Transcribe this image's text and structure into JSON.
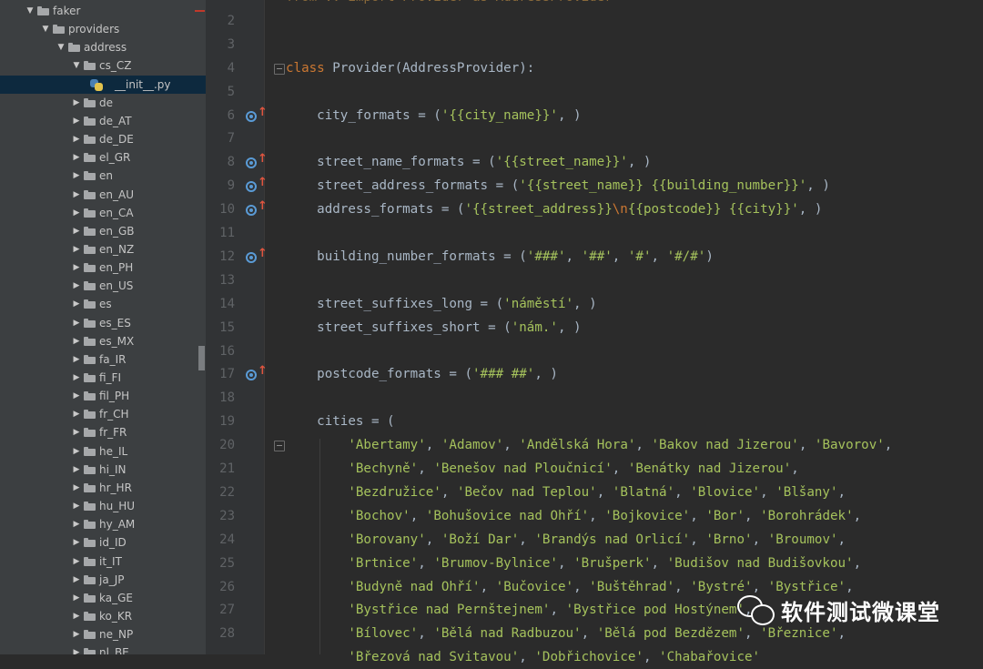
{
  "project_tree": [
    {
      "label": "faker",
      "depth": 0,
      "expanded": true,
      "type": "folder"
    },
    {
      "label": "providers",
      "depth": 1,
      "expanded": true,
      "type": "folder"
    },
    {
      "label": "address",
      "depth": 2,
      "expanded": true,
      "type": "folder"
    },
    {
      "label": "cs_CZ",
      "depth": 3,
      "expanded": true,
      "type": "folder"
    },
    {
      "label": "__init__.py",
      "depth": 4,
      "type": "python-file",
      "selected": true
    },
    {
      "label": "de",
      "depth": 3,
      "expanded": false,
      "type": "folder"
    },
    {
      "label": "de_AT",
      "depth": 3,
      "expanded": false,
      "type": "folder"
    },
    {
      "label": "de_DE",
      "depth": 3,
      "expanded": false,
      "type": "folder"
    },
    {
      "label": "el_GR",
      "depth": 3,
      "expanded": false,
      "type": "folder"
    },
    {
      "label": "en",
      "depth": 3,
      "expanded": false,
      "type": "folder"
    },
    {
      "label": "en_AU",
      "depth": 3,
      "expanded": false,
      "type": "folder"
    },
    {
      "label": "en_CA",
      "depth": 3,
      "expanded": false,
      "type": "folder"
    },
    {
      "label": "en_GB",
      "depth": 3,
      "expanded": false,
      "type": "folder"
    },
    {
      "label": "en_NZ",
      "depth": 3,
      "expanded": false,
      "type": "folder"
    },
    {
      "label": "en_PH",
      "depth": 3,
      "expanded": false,
      "type": "folder"
    },
    {
      "label": "en_US",
      "depth": 3,
      "expanded": false,
      "type": "folder"
    },
    {
      "label": "es",
      "depth": 3,
      "expanded": false,
      "type": "folder"
    },
    {
      "label": "es_ES",
      "depth": 3,
      "expanded": false,
      "type": "folder"
    },
    {
      "label": "es_MX",
      "depth": 3,
      "expanded": false,
      "type": "folder"
    },
    {
      "label": "fa_IR",
      "depth": 3,
      "expanded": false,
      "type": "folder"
    },
    {
      "label": "fi_FI",
      "depth": 3,
      "expanded": false,
      "type": "folder"
    },
    {
      "label": "fil_PH",
      "depth": 3,
      "expanded": false,
      "type": "folder"
    },
    {
      "label": "fr_CH",
      "depth": 3,
      "expanded": false,
      "type": "folder"
    },
    {
      "label": "fr_FR",
      "depth": 3,
      "expanded": false,
      "type": "folder"
    },
    {
      "label": "he_IL",
      "depth": 3,
      "expanded": false,
      "type": "folder"
    },
    {
      "label": "hi_IN",
      "depth": 3,
      "expanded": false,
      "type": "folder"
    },
    {
      "label": "hr_HR",
      "depth": 3,
      "expanded": false,
      "type": "folder"
    },
    {
      "label": "hu_HU",
      "depth": 3,
      "expanded": false,
      "type": "folder"
    },
    {
      "label": "hy_AM",
      "depth": 3,
      "expanded": false,
      "type": "folder"
    },
    {
      "label": "id_ID",
      "depth": 3,
      "expanded": false,
      "type": "folder"
    },
    {
      "label": "it_IT",
      "depth": 3,
      "expanded": false,
      "type": "folder"
    },
    {
      "label": "ja_JP",
      "depth": 3,
      "expanded": false,
      "type": "folder"
    },
    {
      "label": "ka_GE",
      "depth": 3,
      "expanded": false,
      "type": "folder"
    },
    {
      "label": "ko_KR",
      "depth": 3,
      "expanded": false,
      "type": "folder"
    },
    {
      "label": "ne_NP",
      "depth": 3,
      "expanded": false,
      "type": "folder"
    },
    {
      "label": "nl_BE",
      "depth": 3,
      "expanded": false,
      "type": "folder"
    }
  ],
  "editor_lines": [
    {
      "n": "",
      "segs": [
        {
          "t": "from .. import Provider as AddressProvider",
          "k": "dim"
        }
      ]
    },
    {
      "n": "2",
      "segs": []
    },
    {
      "n": "3",
      "segs": []
    },
    {
      "n": "4",
      "fold": true,
      "segs": [
        {
          "t": "class ",
          "k": "kw"
        },
        {
          "t": "Provider(AddressProvider):",
          "k": "plain"
        }
      ]
    },
    {
      "n": "5",
      "segs": []
    },
    {
      "n": "6",
      "override": true,
      "segs": [
        {
          "t": "    city_formats = (",
          "k": "plain"
        },
        {
          "t": "'{{city_name}}'",
          "k": "str"
        },
        {
          "t": ", )",
          "k": "plain"
        }
      ]
    },
    {
      "n": "7",
      "segs": []
    },
    {
      "n": "8",
      "override": true,
      "segs": [
        {
          "t": "    street_name_formats = (",
          "k": "plain"
        },
        {
          "t": "'{{street_name}}'",
          "k": "str"
        },
        {
          "t": ", )",
          "k": "plain"
        }
      ]
    },
    {
      "n": "9",
      "override": true,
      "segs": [
        {
          "t": "    street_address_formats = (",
          "k": "plain"
        },
        {
          "t": "'{{street_name}} {{building_number}}'",
          "k": "str"
        },
        {
          "t": ", )",
          "k": "plain"
        }
      ]
    },
    {
      "n": "10",
      "override": true,
      "segs": [
        {
          "t": "    address_formats = (",
          "k": "plain"
        },
        {
          "t": "'{{street_address}}",
          "k": "str"
        },
        {
          "t": "\\n",
          "k": "esc"
        },
        {
          "t": "{{postcode}} {{city}}'",
          "k": "str"
        },
        {
          "t": ", )",
          "k": "plain"
        }
      ]
    },
    {
      "n": "11",
      "segs": []
    },
    {
      "n": "12",
      "override": true,
      "segs": [
        {
          "t": "    building_number_formats = (",
          "k": "plain"
        },
        {
          "t": "'###'",
          "k": "str"
        },
        {
          "t": ", ",
          "k": "plain"
        },
        {
          "t": "'##'",
          "k": "str"
        },
        {
          "t": ", ",
          "k": "plain"
        },
        {
          "t": "'#'",
          "k": "str"
        },
        {
          "t": ", ",
          "k": "plain"
        },
        {
          "t": "'#/#'",
          "k": "str"
        },
        {
          "t": ")",
          "k": "plain"
        }
      ]
    },
    {
      "n": "13",
      "segs": []
    },
    {
      "n": "14",
      "segs": [
        {
          "t": "    street_suffixes_long = (",
          "k": "plain"
        },
        {
          "t": "'náměstí'",
          "k": "str"
        },
        {
          "t": ", )",
          "k": "plain"
        }
      ]
    },
    {
      "n": "15",
      "segs": [
        {
          "t": "    street_suffixes_short = (",
          "k": "plain"
        },
        {
          "t": "'nám.'",
          "k": "str"
        },
        {
          "t": ", )",
          "k": "plain"
        }
      ]
    },
    {
      "n": "16",
      "segs": []
    },
    {
      "n": "17",
      "override": true,
      "segs": [
        {
          "t": "    postcode_formats = (",
          "k": "plain"
        },
        {
          "t": "'### ##'",
          "k": "str"
        },
        {
          "t": ", )",
          "k": "plain"
        }
      ]
    },
    {
      "n": "18",
      "segs": []
    },
    {
      "n": "19",
      "segs": [
        {
          "t": "    cities = (",
          "k": "plain"
        }
      ]
    },
    {
      "n": "20",
      "fold": true,
      "segs": [
        {
          "t": "        ",
          "k": "plain"
        },
        {
          "t": "'Abertamy'",
          "k": "str"
        },
        {
          "t": ", ",
          "k": "plain"
        },
        {
          "t": "'Adamov'",
          "k": "str"
        },
        {
          "t": ", ",
          "k": "plain"
        },
        {
          "t": "'Andělská Hora'",
          "k": "str"
        },
        {
          "t": ", ",
          "k": "plain"
        },
        {
          "t": "'Bakov nad Jizerou'",
          "k": "str"
        },
        {
          "t": ", ",
          "k": "plain"
        },
        {
          "t": "'Bavorov'",
          "k": "str"
        },
        {
          "t": ",",
          "k": "plain"
        }
      ]
    },
    {
      "n": "21",
      "segs": [
        {
          "t": "        ",
          "k": "plain"
        },
        {
          "t": "'Bechyně'",
          "k": "str"
        },
        {
          "t": ", ",
          "k": "plain"
        },
        {
          "t": "'Benešov nad Ploučnicí'",
          "k": "str"
        },
        {
          "t": ", ",
          "k": "plain"
        },
        {
          "t": "'Benátky nad Jizerou'",
          "k": "str"
        },
        {
          "t": ",",
          "k": "plain"
        }
      ]
    },
    {
      "n": "22",
      "segs": [
        {
          "t": "        ",
          "k": "plain"
        },
        {
          "t": "'Bezdružice'",
          "k": "str"
        },
        {
          "t": ", ",
          "k": "plain"
        },
        {
          "t": "'Bečov nad Teplou'",
          "k": "str"
        },
        {
          "t": ", ",
          "k": "plain"
        },
        {
          "t": "'Blatná'",
          "k": "str"
        },
        {
          "t": ", ",
          "k": "plain"
        },
        {
          "t": "'Blovice'",
          "k": "str"
        },
        {
          "t": ", ",
          "k": "plain"
        },
        {
          "t": "'Blšany'",
          "k": "str"
        },
        {
          "t": ",",
          "k": "plain"
        }
      ]
    },
    {
      "n": "23",
      "segs": [
        {
          "t": "        ",
          "k": "plain"
        },
        {
          "t": "'Bochov'",
          "k": "str"
        },
        {
          "t": ", ",
          "k": "plain"
        },
        {
          "t": "'Bohušovice nad Ohří'",
          "k": "str"
        },
        {
          "t": ", ",
          "k": "plain"
        },
        {
          "t": "'Bojkovice'",
          "k": "str"
        },
        {
          "t": ", ",
          "k": "plain"
        },
        {
          "t": "'Bor'",
          "k": "str"
        },
        {
          "t": ", ",
          "k": "plain"
        },
        {
          "t": "'Borohrádek'",
          "k": "str"
        },
        {
          "t": ",",
          "k": "plain"
        }
      ]
    },
    {
      "n": "24",
      "segs": [
        {
          "t": "        ",
          "k": "plain"
        },
        {
          "t": "'Borovany'",
          "k": "str"
        },
        {
          "t": ", ",
          "k": "plain"
        },
        {
          "t": "'Boží Dar'",
          "k": "str"
        },
        {
          "t": ", ",
          "k": "plain"
        },
        {
          "t": "'Brandýs nad Orlicí'",
          "k": "str"
        },
        {
          "t": ", ",
          "k": "plain"
        },
        {
          "t": "'Brno'",
          "k": "str"
        },
        {
          "t": ", ",
          "k": "plain"
        },
        {
          "t": "'Broumov'",
          "k": "str"
        },
        {
          "t": ",",
          "k": "plain"
        }
      ]
    },
    {
      "n": "25",
      "segs": [
        {
          "t": "        ",
          "k": "plain"
        },
        {
          "t": "'Brtnice'",
          "k": "str"
        },
        {
          "t": ", ",
          "k": "plain"
        },
        {
          "t": "'Brumov-Bylnice'",
          "k": "str"
        },
        {
          "t": ", ",
          "k": "plain"
        },
        {
          "t": "'Brušperk'",
          "k": "str"
        },
        {
          "t": ", ",
          "k": "plain"
        },
        {
          "t": "'Budišov nad Budišovkou'",
          "k": "str"
        },
        {
          "t": ",",
          "k": "plain"
        }
      ]
    },
    {
      "n": "26",
      "segs": [
        {
          "t": "        ",
          "k": "plain"
        },
        {
          "t": "'Budyně nad Ohří'",
          "k": "str"
        },
        {
          "t": ", ",
          "k": "plain"
        },
        {
          "t": "'Bučovice'",
          "k": "str"
        },
        {
          "t": ", ",
          "k": "plain"
        },
        {
          "t": "'Buštěhrad'",
          "k": "str"
        },
        {
          "t": ", ",
          "k": "plain"
        },
        {
          "t": "'Bystré'",
          "k": "str"
        },
        {
          "t": ", ",
          "k": "plain"
        },
        {
          "t": "'Bystřice'",
          "k": "str"
        },
        {
          "t": ",",
          "k": "plain"
        }
      ]
    },
    {
      "n": "27",
      "segs": [
        {
          "t": "        ",
          "k": "plain"
        },
        {
          "t": "'Bystřice nad Pernštejnem'",
          "k": "str"
        },
        {
          "t": ", ",
          "k": "plain"
        },
        {
          "t": "'Bystřice pod Hostýnem'",
          "k": "str"
        },
        {
          "t": ",",
          "k": "plain"
        }
      ]
    },
    {
      "n": "28",
      "segs": [
        {
          "t": "        ",
          "k": "plain"
        },
        {
          "t": "'Bílovec'",
          "k": "str"
        },
        {
          "t": ", ",
          "k": "plain"
        },
        {
          "t": "'Bělá nad Radbuzou'",
          "k": "str"
        },
        {
          "t": ", ",
          "k": "plain"
        },
        {
          "t": "'Bělá pod Bezdězem'",
          "k": "str"
        },
        {
          "t": ", ",
          "k": "plain"
        },
        {
          "t": "'Březnice'",
          "k": "str"
        },
        {
          "t": ",",
          "k": "plain"
        }
      ]
    },
    {
      "n": "",
      "segs": [
        {
          "t": "        ",
          "k": "plain"
        },
        {
          "t": "'Březová nad Svitavou'",
          "k": "str"
        },
        {
          "t": ", ",
          "k": "plain"
        },
        {
          "t": "'Dobřichovice'",
          "k": "str"
        },
        {
          "t": ", ",
          "k": "plain"
        },
        {
          "t": "'Chabařovice'",
          "k": "str"
        }
      ]
    }
  ],
  "syntax_colors": {
    "kw": "#cc7832",
    "plain": "#a9b7c6",
    "str": "#a5c25c",
    "esc": "#cc7832",
    "dim": "#8a6a3a"
  },
  "icons": {
    "override_marker": "override-up-icon",
    "fold_marker": "fold-icon",
    "file_type": "python-file-icon",
    "folder": "folder-icon"
  },
  "watermark": {
    "text": "软件测试微课堂",
    "icon": "wechat-icon"
  }
}
